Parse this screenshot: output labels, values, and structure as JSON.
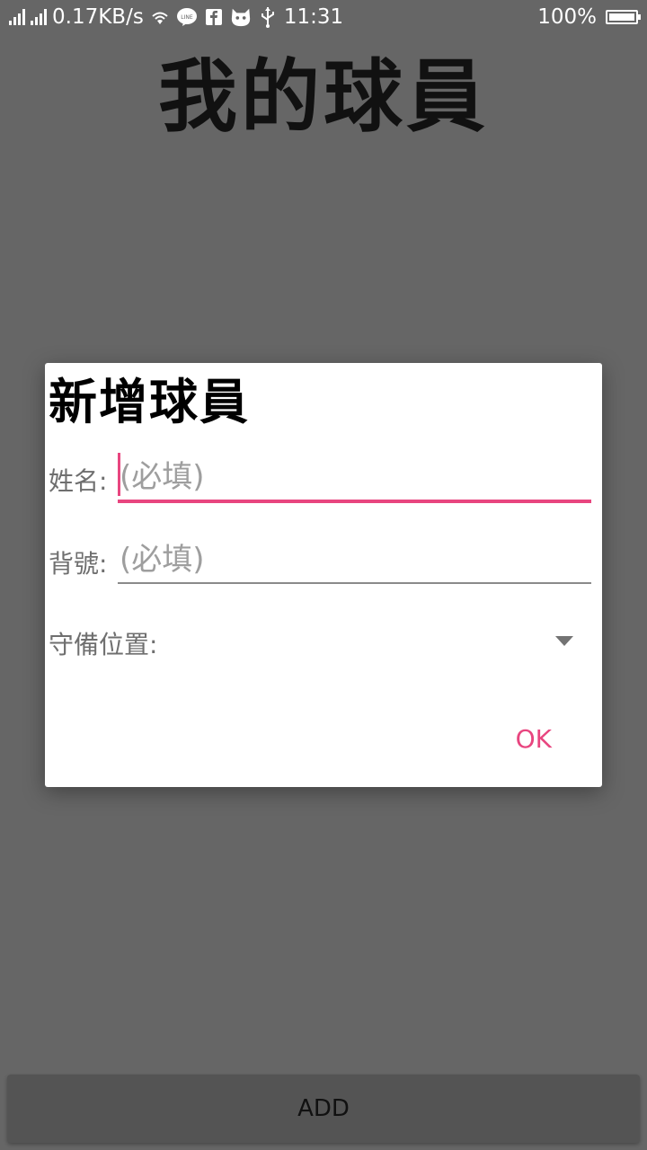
{
  "status_bar": {
    "net_speed": "0.17KB/s",
    "time": "11:31",
    "battery": "100%",
    "icons": [
      "signal-icon",
      "signal-icon",
      "wifi-icon",
      "line-icon",
      "facebook-icon",
      "cat-app-icon",
      "usb-icon",
      "battery-icon"
    ]
  },
  "app": {
    "title": "我的球員"
  },
  "dialog": {
    "title": "新增球員",
    "name_label": "姓名:",
    "name_placeholder": "(必填)",
    "number_label": "背號:",
    "number_placeholder": "(必填)",
    "position_label": "守備位置:",
    "ok_label": "OK"
  },
  "footer": {
    "add_label": "ADD"
  },
  "colors": {
    "accent": "#e8457f",
    "scrim_background": "#666666"
  }
}
